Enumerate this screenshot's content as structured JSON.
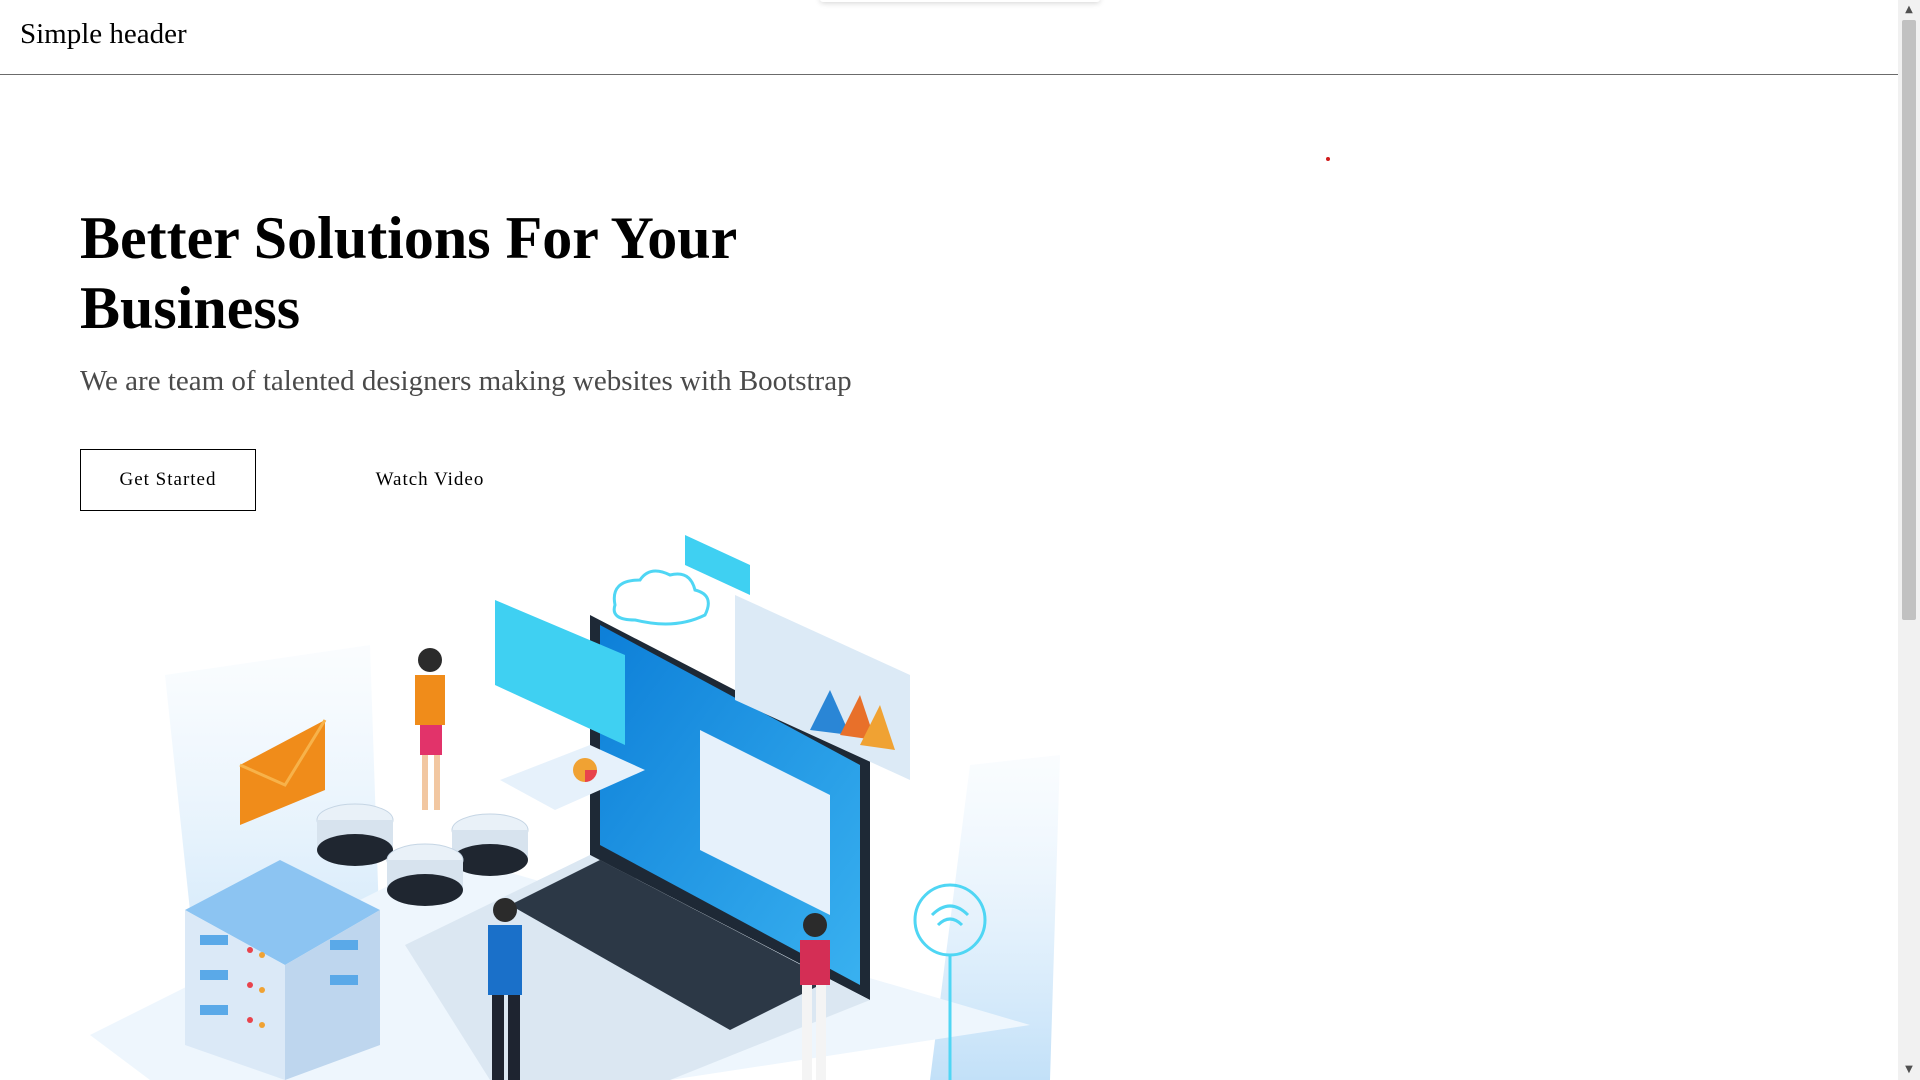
{
  "header": {
    "brand": "Simple header"
  },
  "hero": {
    "title": "Better Solutions For Your Business",
    "subtitle": "We are team of talented designers making websites with Bootstrap",
    "primary_button": "Get Started",
    "secondary_button": "Watch Video"
  },
  "illustration": {
    "icon": "isometric-tech-illustration"
  },
  "scrollbar": {
    "up_glyph": "▲",
    "down_glyph": "▼"
  }
}
